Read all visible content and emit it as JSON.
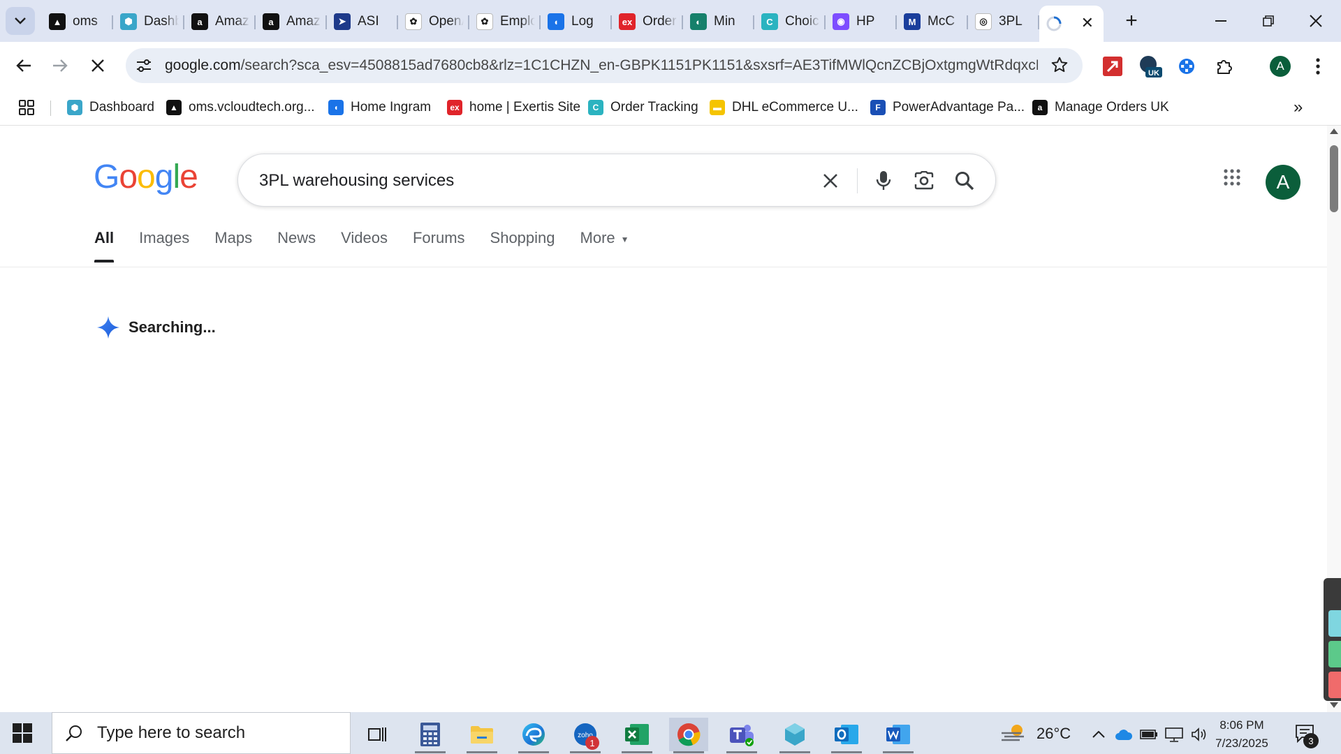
{
  "tabs": [
    {
      "title": "oms",
      "icon": "vcloud-icon",
      "color": "#111111",
      "glyph": "▲"
    },
    {
      "title": "Dashboard",
      "icon": "dashboard-hexagon-icon",
      "color": "#3aa6c9",
      "glyph": "⬢"
    },
    {
      "title": "Amazon",
      "icon": "amazon-icon",
      "color": "#111111",
      "glyph": "a"
    },
    {
      "title": "Amazon",
      "icon": "amazon-icon",
      "color": "#111111",
      "glyph": "a"
    },
    {
      "title": "ASI",
      "icon": "asi-arrow-icon",
      "color": "#1e3a8a",
      "glyph": "➤"
    },
    {
      "title": "OpenAI",
      "icon": "openai-icon",
      "color": "#ffffff",
      "glyph": "✿"
    },
    {
      "title": "Employee",
      "icon": "openai-icon",
      "color": "#ffffff",
      "glyph": "✿"
    },
    {
      "title": "Log",
      "icon": "ingram-icon",
      "color": "#1a73e8",
      "glyph": "◖"
    },
    {
      "title": "Order",
      "icon": "exertis-icon",
      "color": "#e0242a",
      "glyph": "ex"
    },
    {
      "title": "Min",
      "icon": "leaf-icon",
      "color": "#16806b",
      "glyph": "◐"
    },
    {
      "title": "Choice",
      "icon": "choice-icon",
      "color": "#2bb3c0",
      "glyph": "C"
    },
    {
      "title": "HP",
      "icon": "hp-icon",
      "color": "#7d4dff",
      "glyph": "◉"
    },
    {
      "title": "McC",
      "icon": "m-logo-icon",
      "color": "#1a3e9c",
      "glyph": "M"
    },
    {
      "title": "3PL",
      "icon": "ams-icon",
      "color": "#ffffff",
      "glyph": "◎"
    }
  ],
  "active_tab": {
    "icon": "loading-globe-icon",
    "close": "✕"
  },
  "new_tab_label": "+",
  "url": {
    "domain": "google.com",
    "rest": "/search?sca_esv=4508815ad7680cb8&rlz=1C1CHZN_en-GBPK1151PK1151&sxsrf=AE3TifMWlQcnZCBjOxtgmgWtRdqxcM..."
  },
  "profile_initial": "A",
  "extensions": [
    {
      "icon": "pdf-arrow-icon",
      "color": "#d32f2f"
    },
    {
      "icon": "uk-vpn-icon",
      "color": "#0b4a6f",
      "label": "UK"
    },
    {
      "icon": "puzzle-blue-icon",
      "color": "#1a73e8"
    },
    {
      "icon": "extensions-icon",
      "color": "#1f1f1f"
    }
  ],
  "bookmarks": [
    {
      "label": "Dashboard",
      "color": "#3aa6c9",
      "glyph": "⬢"
    },
    {
      "label": "oms.vcloudtech.org...",
      "color": "#111111",
      "glyph": "▲"
    },
    {
      "label": "Home Ingram",
      "color": "#1a73e8",
      "glyph": "◖"
    },
    {
      "label": "home | Exertis Site",
      "color": "#e0242a",
      "glyph": "ex"
    },
    {
      "label": "Order Tracking",
      "color": "#2bb3c0",
      "glyph": "C"
    },
    {
      "label": "DHL eCommerce U...",
      "color": "#f5c400",
      "glyph": "▬"
    },
    {
      "label": "PowerAdvantage Pa...",
      "color": "#1a4fb5",
      "glyph": "F"
    },
    {
      "label": "Manage Orders UK",
      "color": "#111111",
      "glyph": "a"
    }
  ],
  "bookmarks_more": "»",
  "google": {
    "logo_letters": [
      {
        "ch": "G",
        "color": "#4285F4"
      },
      {
        "ch": "o",
        "color": "#EA4335"
      },
      {
        "ch": "o",
        "color": "#FBBC05"
      },
      {
        "ch": "g",
        "color": "#4285F4"
      },
      {
        "ch": "l",
        "color": "#34A853"
      },
      {
        "ch": "e",
        "color": "#EA4335"
      }
    ],
    "query": "3PL warehousing services",
    "avatar_initial": "A",
    "tabs": [
      {
        "label": "All",
        "active": true
      },
      {
        "label": "Images"
      },
      {
        "label": "Maps"
      },
      {
        "label": "News"
      },
      {
        "label": "Videos"
      },
      {
        "label": "Forums"
      },
      {
        "label": "Shopping"
      },
      {
        "label": "More",
        "caret": true
      }
    ],
    "status": "Searching..."
  },
  "taskbar": {
    "search_placeholder": "Type here to search",
    "apps": [
      {
        "name": "task-view",
        "icon": "task-view-icon"
      },
      {
        "name": "calculator",
        "icon": "calculator-icon"
      },
      {
        "name": "file-explorer",
        "icon": "folder-icon"
      },
      {
        "name": "edge",
        "icon": "edge-icon"
      },
      {
        "name": "zoho",
        "icon": "zoho-icon",
        "badge": "1"
      },
      {
        "name": "excel",
        "icon": "excel-icon"
      },
      {
        "name": "chrome",
        "icon": "chrome-icon"
      },
      {
        "name": "teams",
        "icon": "teams-icon"
      },
      {
        "name": "app-hex",
        "icon": "hexagon-app-icon"
      },
      {
        "name": "outlook",
        "icon": "outlook-icon"
      },
      {
        "name": "word",
        "icon": "word-icon"
      }
    ],
    "weather": "26°C",
    "time": "8:06 PM",
    "date": "7/23/2025",
    "notifications": "3"
  }
}
